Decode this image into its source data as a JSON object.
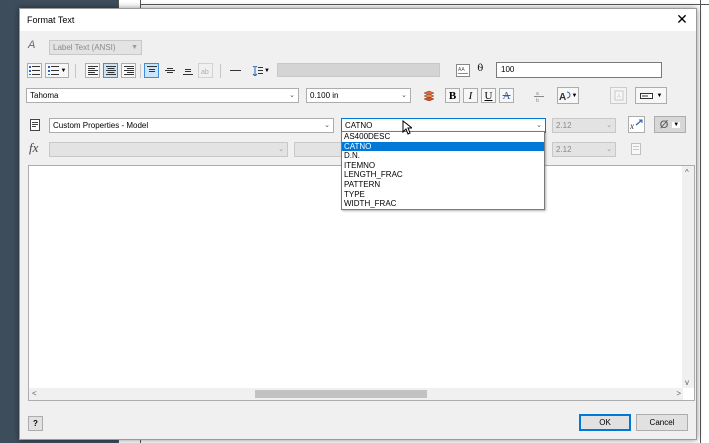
{
  "dialog": {
    "title": "Format Text"
  },
  "row1": {
    "style_select": "Label Text (ANSI)",
    "tracking_value": "100"
  },
  "row2": {
    "font": "Tahoma",
    "size": "0.100 in",
    "bold": "B",
    "italic": "I",
    "underline": "U",
    "strike": "A"
  },
  "row3": {
    "type_select": "Custom Properties - Model",
    "property_select": "CATNO",
    "precision": "2.12",
    "options": [
      "AS400DESC",
      "CATNO",
      "D.N.",
      "ITEMNO",
      "LENGTH_FRAC",
      "PATTERN",
      "TYPE",
      "WIDTH_FRAC"
    ],
    "selected_option": "CATNO"
  },
  "row4": {
    "fx_label": "fx",
    "precision": "2.12"
  },
  "buttons": {
    "help": "?",
    "ok": "OK",
    "cancel": "Cancel"
  },
  "icons": {
    "diameter": "Ø"
  }
}
